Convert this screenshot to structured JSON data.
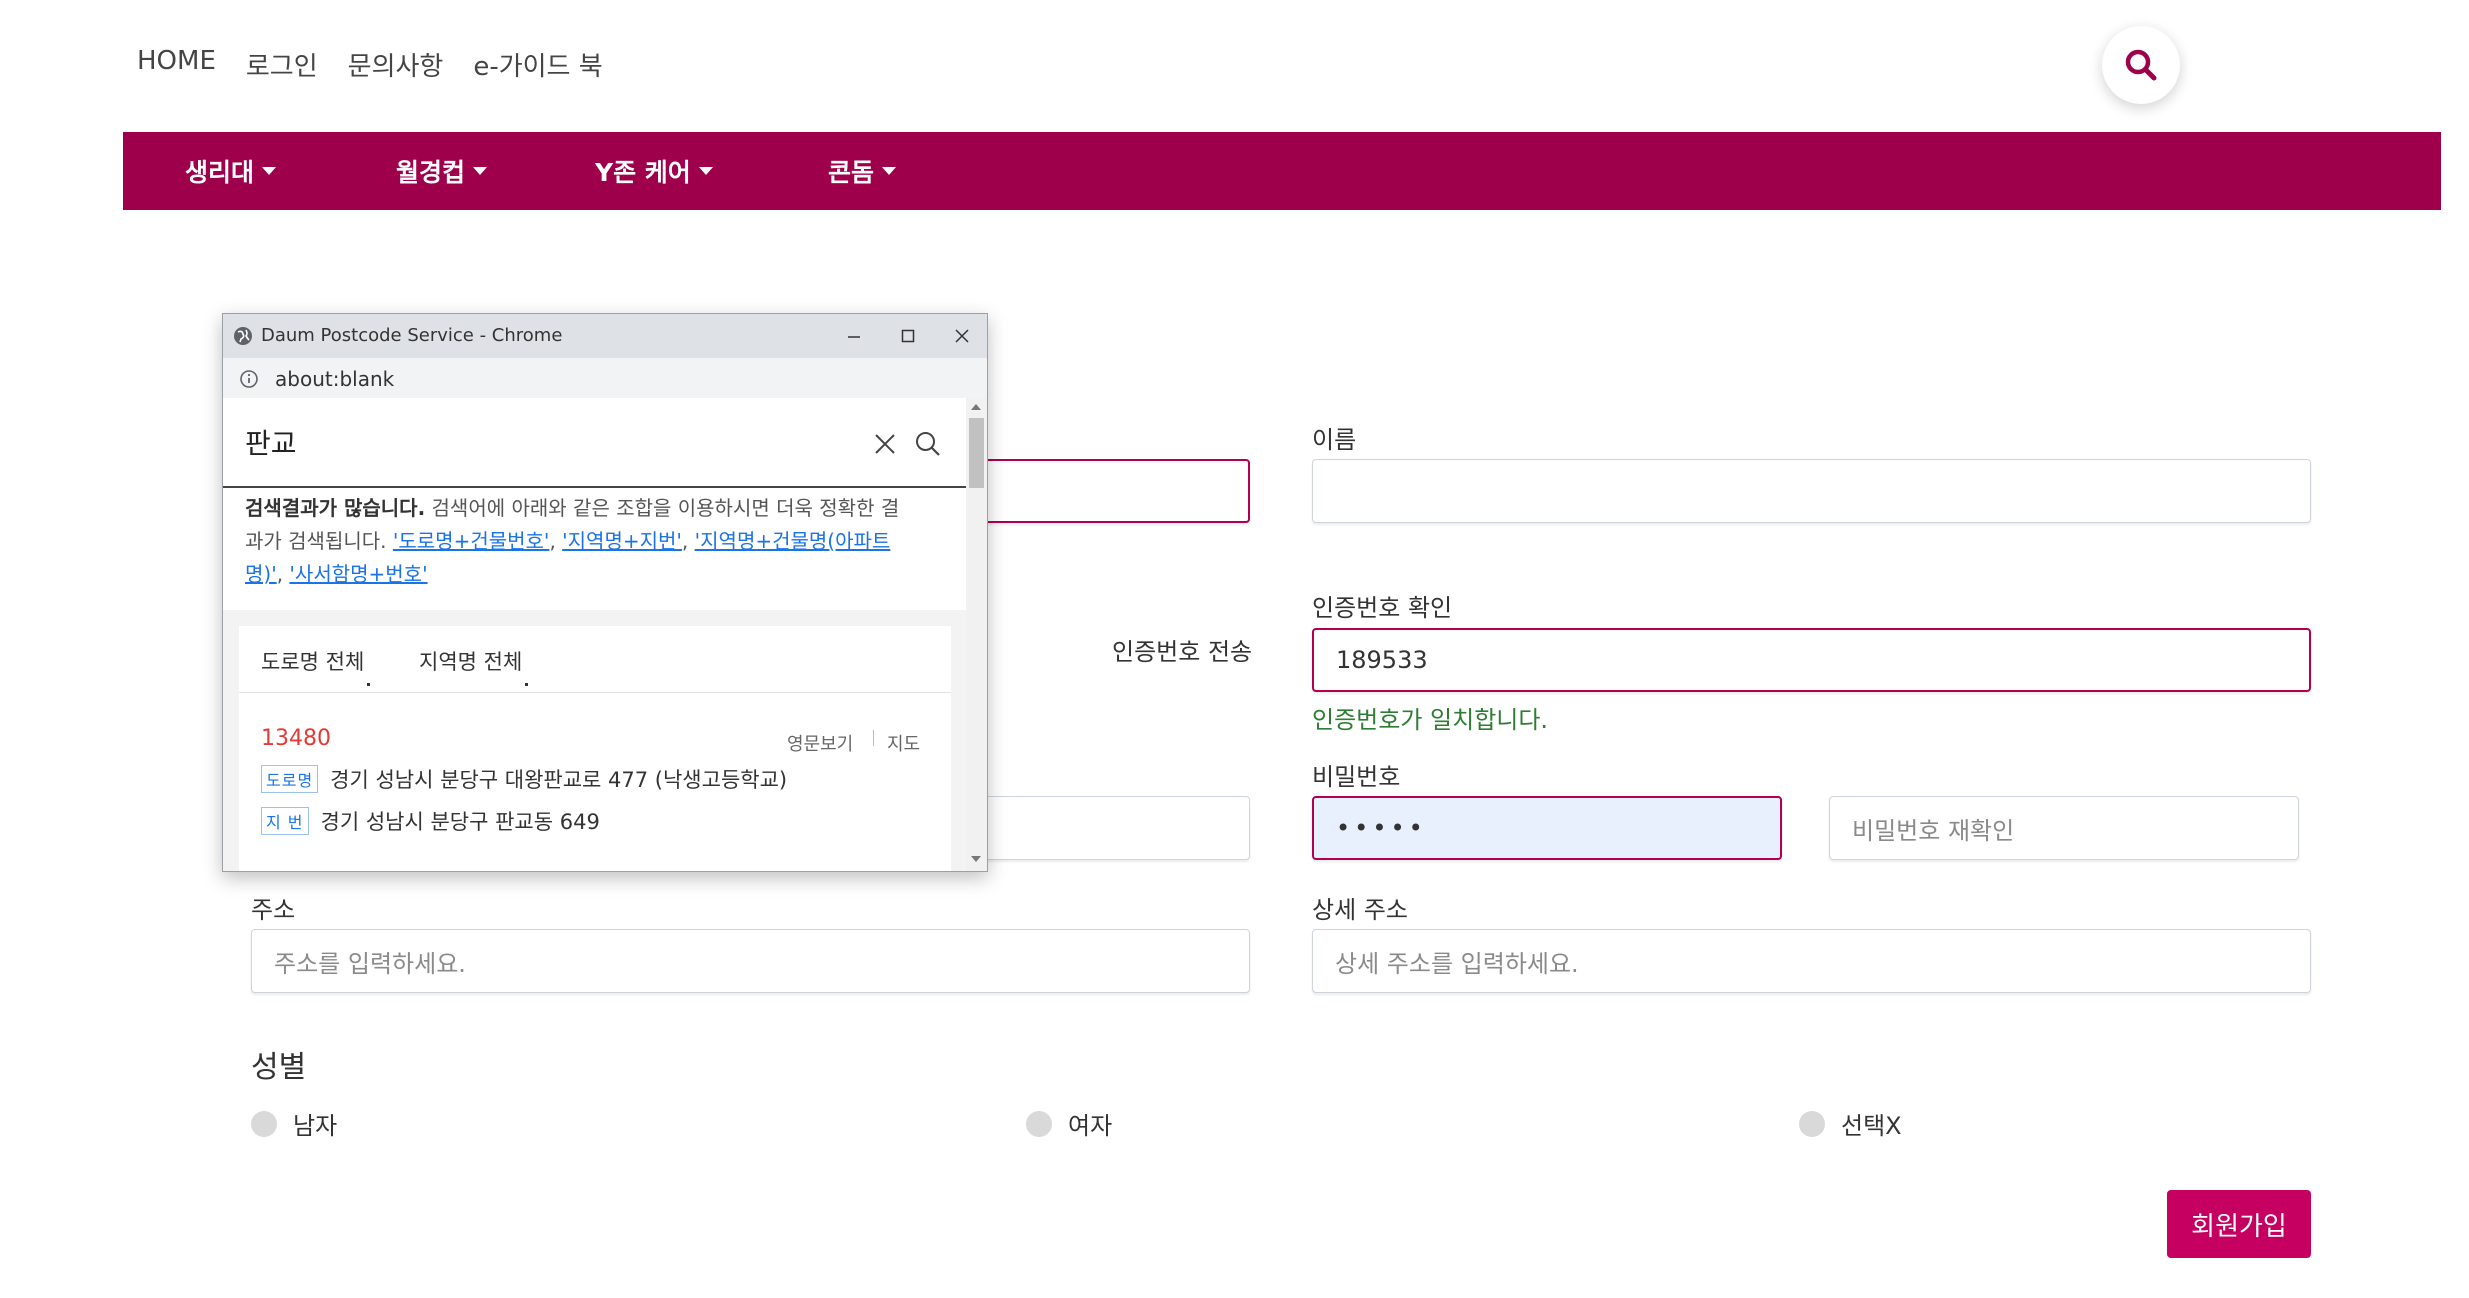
{
  "top_links": [
    "HOME",
    "로그인",
    "문의사항",
    "e-가이드 북"
  ],
  "icons": {
    "search": "search-icon",
    "caret": "caret-down-icon",
    "globe": "globe-icon",
    "info": "info-icon",
    "clear": "close-icon"
  },
  "colors": {
    "brand": "#9e004b",
    "accent": "#c50061",
    "success": "#2e7d32",
    "zip": "#e53935",
    "link": "#1a73e8"
  },
  "nav": {
    "items": [
      "생리대",
      "월경컵",
      "Y존 케어",
      "콘돔"
    ]
  },
  "form": {
    "name_label": "이름",
    "send_code_label": "인증번호 전송",
    "verify_label": "인증번호 확인",
    "verify_value": "189533",
    "verify_success": "인증번호가 일치합니다.",
    "password_label": "비밀번호",
    "password_value": "•••••",
    "password_confirm_placeholder": "비밀번호 재확인",
    "address_label": "주소",
    "address_placeholder": "주소를 입력하세요.",
    "detail_address_label": "상세 주소",
    "detail_address_placeholder": "상세 주소를 입력하세요.",
    "gender_label": "성별",
    "gender_options": [
      "남자",
      "여자",
      "선택X"
    ],
    "submit_label": "회원가입"
  },
  "popup": {
    "window_title": "Daum Postcode Service - Chrome",
    "url": "about:blank",
    "query": "판교",
    "notice_bold": "검색결과가 많습니다.",
    "notice_text_1": " 검색어에 아래와 같은 조합을 이용하시면 더욱 정확한 결",
    "notice_text_2": "과가 검색됩니다.",
    "suggestions": [
      "'도로명+건물번호'",
      "'지역명+지번'",
      "'지역명+건물명(아파트",
      "명)'",
      "'사서함명+번호'"
    ],
    "tabs": [
      "도로명 전체",
      "지역명 전체"
    ],
    "result": {
      "zip": "13480",
      "english_view": "영문보기",
      "map": "지도",
      "road_badge": "도로명",
      "road_address": "경기 성남시 분당구 대왕판교로 477 (낙생고등학교)",
      "jibun_badge": "지 번",
      "jibun_address": "경기 성남시 분당구 판교동 649"
    }
  }
}
